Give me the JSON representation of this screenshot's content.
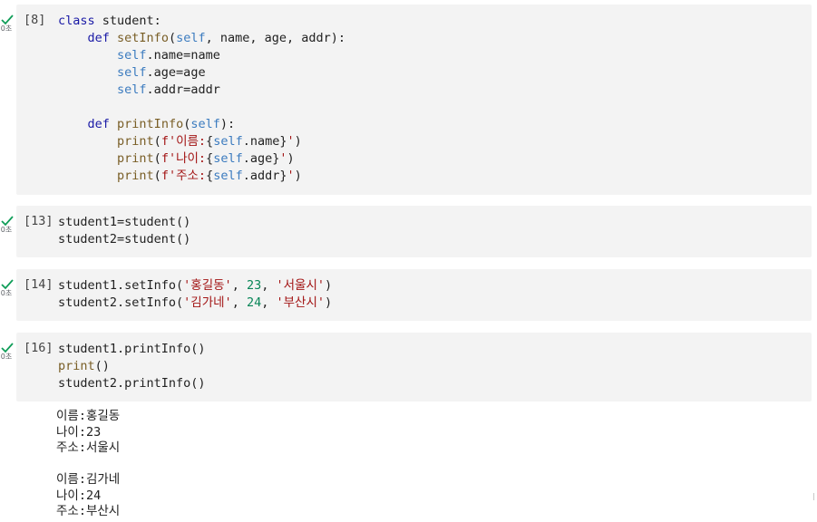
{
  "check_color": "#0f9d58",
  "cells": [
    {
      "exec_count": "[8]",
      "time": "0초",
      "lines": [
        [
          {
            "t": "class",
            "c": "kw"
          },
          {
            "t": " student:",
            "c": "cls"
          }
        ],
        [
          {
            "t": "    ",
            "c": "cls"
          },
          {
            "t": "def",
            "c": "kw"
          },
          {
            "t": " ",
            "c": "cls"
          },
          {
            "t": "setInfo",
            "c": "fn"
          },
          {
            "t": "(",
            "c": "cls"
          },
          {
            "t": "self",
            "c": "self"
          },
          {
            "t": ", name, age, addr):",
            "c": "cls"
          }
        ],
        [
          {
            "t": "        ",
            "c": "cls"
          },
          {
            "t": "self",
            "c": "self"
          },
          {
            "t": ".name=name",
            "c": "cls"
          }
        ],
        [
          {
            "t": "        ",
            "c": "cls"
          },
          {
            "t": "self",
            "c": "self"
          },
          {
            "t": ".age=age",
            "c": "cls"
          }
        ],
        [
          {
            "t": "        ",
            "c": "cls"
          },
          {
            "t": "self",
            "c": "self"
          },
          {
            "t": ".addr=addr",
            "c": "cls"
          }
        ],
        [
          {
            "t": "",
            "c": "cls"
          }
        ],
        [
          {
            "t": "    ",
            "c": "cls"
          },
          {
            "t": "def",
            "c": "kw"
          },
          {
            "t": " ",
            "c": "cls"
          },
          {
            "t": "printInfo",
            "c": "fn"
          },
          {
            "t": "(",
            "c": "cls"
          },
          {
            "t": "self",
            "c": "self"
          },
          {
            "t": "):",
            "c": "cls"
          }
        ],
        [
          {
            "t": "        ",
            "c": "cls"
          },
          {
            "t": "print",
            "c": "fn"
          },
          {
            "t": "(",
            "c": "cls"
          },
          {
            "t": "f'이름:",
            "c": "str"
          },
          {
            "t": "{",
            "c": "cls"
          },
          {
            "t": "self",
            "c": "self"
          },
          {
            "t": ".name}",
            "c": "cls"
          },
          {
            "t": "'",
            "c": "str"
          },
          {
            "t": ")",
            "c": "cls"
          }
        ],
        [
          {
            "t": "        ",
            "c": "cls"
          },
          {
            "t": "print",
            "c": "fn"
          },
          {
            "t": "(",
            "c": "cls"
          },
          {
            "t": "f'나이:",
            "c": "str"
          },
          {
            "t": "{",
            "c": "cls"
          },
          {
            "t": "self",
            "c": "self"
          },
          {
            "t": ".age}",
            "c": "cls"
          },
          {
            "t": "'",
            "c": "str"
          },
          {
            "t": ")",
            "c": "cls"
          }
        ],
        [
          {
            "t": "        ",
            "c": "cls"
          },
          {
            "t": "print",
            "c": "fn"
          },
          {
            "t": "(",
            "c": "cls"
          },
          {
            "t": "f'주소:",
            "c": "str"
          },
          {
            "t": "{",
            "c": "cls"
          },
          {
            "t": "self",
            "c": "self"
          },
          {
            "t": ".addr}",
            "c": "cls"
          },
          {
            "t": "'",
            "c": "str"
          },
          {
            "t": ")",
            "c": "cls"
          }
        ]
      ]
    },
    {
      "exec_count": "[13]",
      "time": "0초",
      "lines": [
        [
          {
            "t": "student1=student()",
            "c": "cls"
          }
        ],
        [
          {
            "t": "student2=student()",
            "c": "cls"
          }
        ]
      ]
    },
    {
      "exec_count": "[14]",
      "time": "0초",
      "lines": [
        [
          {
            "t": "student1.setInfo(",
            "c": "cls"
          },
          {
            "t": "'홍길동'",
            "c": "str"
          },
          {
            "t": ", ",
            "c": "cls"
          },
          {
            "t": "23",
            "c": "num"
          },
          {
            "t": ", ",
            "c": "cls"
          },
          {
            "t": "'서울시'",
            "c": "str"
          },
          {
            "t": ")",
            "c": "cls"
          }
        ],
        [
          {
            "t": "student2.setInfo(",
            "c": "cls"
          },
          {
            "t": "'김가네'",
            "c": "str"
          },
          {
            "t": ", ",
            "c": "cls"
          },
          {
            "t": "24",
            "c": "num"
          },
          {
            "t": ", ",
            "c": "cls"
          },
          {
            "t": "'부산시'",
            "c": "str"
          },
          {
            "t": ")",
            "c": "cls"
          }
        ]
      ]
    },
    {
      "exec_count": "[16]",
      "time": "0초",
      "lines": [
        [
          {
            "t": "student1.printInfo()",
            "c": "cls"
          }
        ],
        [
          {
            "t": "print",
            "c": "fn"
          },
          {
            "t": "()",
            "c": "cls"
          }
        ],
        [
          {
            "t": "student2.printInfo()",
            "c": "cls"
          }
        ]
      ],
      "output": [
        "이름:홍길동",
        "나이:23",
        "주소:서울시",
        "",
        "이름:김가네",
        "나이:24",
        "주소:부산시"
      ]
    }
  ]
}
